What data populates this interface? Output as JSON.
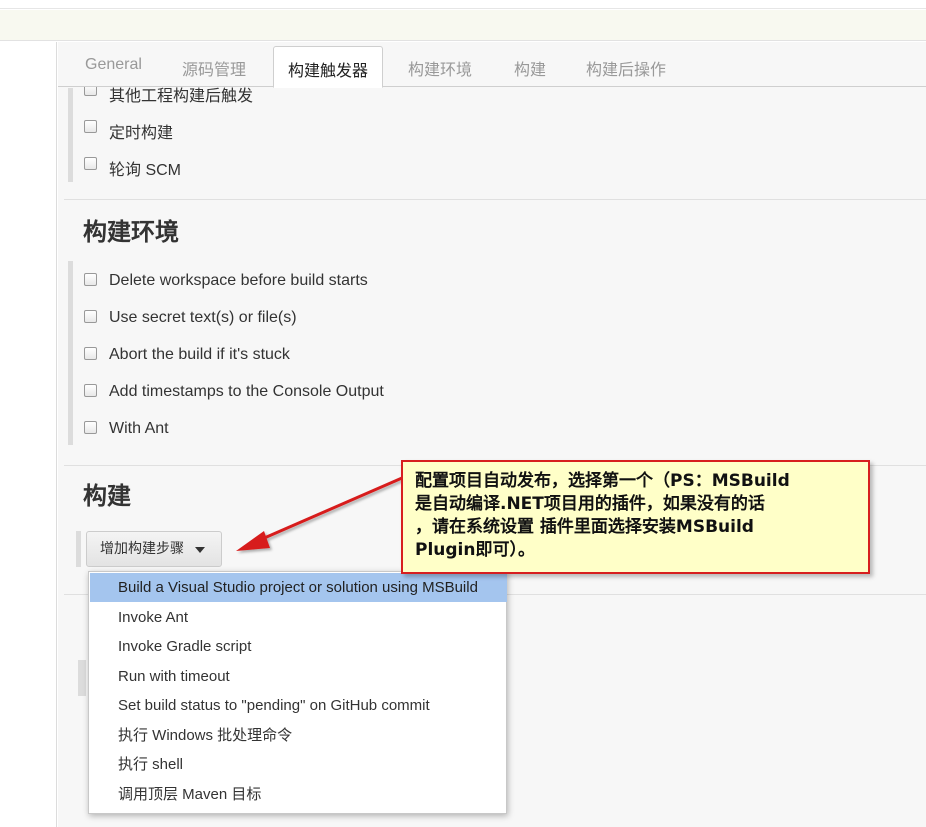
{
  "tabs": [
    {
      "label": "General"
    },
    {
      "label": "源码管理"
    },
    {
      "label": "构建触发器"
    },
    {
      "label": "构建环境"
    },
    {
      "label": "构建"
    },
    {
      "label": "构建后操作"
    }
  ],
  "triggers": {
    "items": [
      {
        "label": "其他工程构建后触发"
      },
      {
        "label": "定时构建"
      },
      {
        "label": "轮询 SCM"
      }
    ]
  },
  "build_env": {
    "title": "构建环境",
    "items": [
      {
        "label": "Delete workspace before build starts"
      },
      {
        "label": "Use secret text(s) or file(s)"
      },
      {
        "label": "Abort the build if it's stuck"
      },
      {
        "label": "Add timestamps to the Console Output"
      },
      {
        "label": "With Ant"
      }
    ]
  },
  "build": {
    "title": "构建",
    "add_step_label": "增加构建步骤"
  },
  "dropdown": {
    "items": [
      {
        "label": "Build a Visual Studio project or solution using MSBuild"
      },
      {
        "label": "Invoke Ant"
      },
      {
        "label": "Invoke Gradle script"
      },
      {
        "label": "Run with timeout"
      },
      {
        "label": "Set build status to \"pending\" on GitHub commit"
      },
      {
        "label": "执行 Windows 批处理命令"
      },
      {
        "label": "执行 shell"
      },
      {
        "label": "调用顶层 Maven 目标"
      }
    ]
  },
  "callout": {
    "lines": [
      "配置项目自动发布，选择第一个（PS：MSBuild",
      "是自动编译.NET项目用的插件，如果没有的话",
      "，请在系统设置 插件里面选择安装MSBuild",
      "Plugin即可）。"
    ]
  },
  "colors": {
    "highlight": "#a4c5ee",
    "callout_bg": "#ffffc8",
    "callout_border": "#d71f1f",
    "arrow": "#d71f1f"
  }
}
